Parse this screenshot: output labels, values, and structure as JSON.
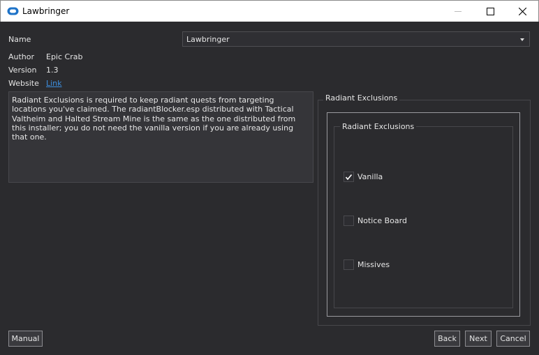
{
  "window": {
    "title": "Lawbringer",
    "app_icon": "cloud-icon",
    "controls": [
      "minimize-icon",
      "maximize-icon",
      "close-icon"
    ]
  },
  "info": {
    "name_label": "Name",
    "name_value": "Lawbringer",
    "author_label": "Author",
    "author_value": "Epic Crab",
    "version_label": "Version",
    "version_value": "1.3",
    "website_label": "Website",
    "website_link": "Link"
  },
  "description": "Radiant Exclusions is required to keep radiant quests from targeting locations you've claimed. The radiantBlocker.esp distributed with Tactical Valtheim and Halted Stream Mine is the same as the one distributed from this installer; you do not need the vanilla version if you are already using that one.",
  "group": {
    "outer_title": "Radiant Exclusions",
    "inner_title": "Radiant Exclusions",
    "options": [
      {
        "label": "Vanilla",
        "checked": true
      },
      {
        "label": "Notice Board",
        "checked": false
      },
      {
        "label": "Missives",
        "checked": false
      }
    ]
  },
  "buttons": {
    "manual": "Manual",
    "back": "Back",
    "next": "Next",
    "cancel": "Cancel"
  },
  "colors": {
    "background": "#2b2b2e",
    "accent_link": "#3d8fe0",
    "app_icon": "#1e73c8"
  }
}
